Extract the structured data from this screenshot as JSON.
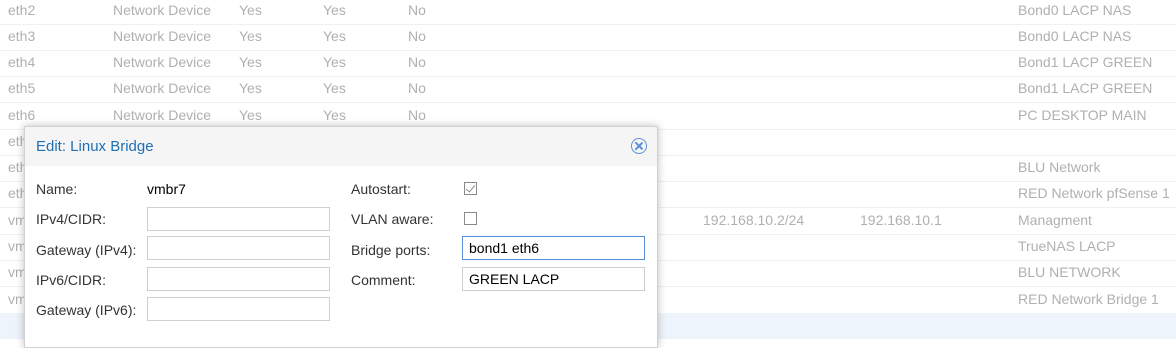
{
  "rows": [
    {
      "name": "eth2",
      "type": "Network Device",
      "active": "Yes",
      "autostart": "Yes",
      "vlan": "No",
      "cidr": "",
      "gateway": "",
      "comment": "Bond0 LACP NAS"
    },
    {
      "name": "eth3",
      "type": "Network Device",
      "active": "Yes",
      "autostart": "Yes",
      "vlan": "No",
      "cidr": "",
      "gateway": "",
      "comment": "Bond0 LACP NAS"
    },
    {
      "name": "eth4",
      "type": "Network Device",
      "active": "Yes",
      "autostart": "Yes",
      "vlan": "No",
      "cidr": "",
      "gateway": "",
      "comment": "Bond1 LACP GREEN"
    },
    {
      "name": "eth5",
      "type": "Network Device",
      "active": "Yes",
      "autostart": "Yes",
      "vlan": "No",
      "cidr": "",
      "gateway": "",
      "comment": "Bond1 LACP GREEN"
    },
    {
      "name": "eth6",
      "type": "Network Device",
      "active": "Yes",
      "autostart": "Yes",
      "vlan": "No",
      "cidr": "",
      "gateway": "",
      "comment": "PC DESKTOP MAIN"
    },
    {
      "name": "eth",
      "type": "",
      "active": "",
      "autostart": "",
      "vlan": "",
      "cidr": "",
      "gateway": "",
      "comment": ""
    },
    {
      "name": "eth",
      "type": "",
      "active": "",
      "autostart": "",
      "vlan": "",
      "cidr": "",
      "gateway": "",
      "comment": "BLU Network"
    },
    {
      "name": "eth",
      "type": "",
      "active": "",
      "autostart": "",
      "vlan": "",
      "cidr": "",
      "gateway": "",
      "comment": "RED Network pfSense 1"
    },
    {
      "name": "vm",
      "type": "",
      "active": "",
      "autostart": "",
      "vlan": "",
      "cidr": "192.168.10.2/24",
      "gateway": "192.168.10.1",
      "comment": "Managment"
    },
    {
      "name": "vm",
      "type": "",
      "active": "",
      "autostart": "",
      "vlan": "",
      "cidr": "",
      "gateway": "",
      "comment": "TrueNAS LACP"
    },
    {
      "name": "vm",
      "type": "",
      "active": "",
      "autostart": "",
      "vlan": "",
      "cidr": "",
      "gateway": "",
      "comment": "BLU NETWORK"
    },
    {
      "name": "vm",
      "type": "",
      "active": "",
      "autostart": "",
      "vlan": "",
      "cidr": "",
      "gateway": "",
      "comment": "RED Network Bridge 1"
    }
  ],
  "dialog": {
    "title": "Edit: Linux Bridge",
    "close_icon": "close-circle-icon",
    "name_label": "Name:",
    "name_value": "vmbr7",
    "ipv4_label": "IPv4/CIDR:",
    "ipv4_value": "",
    "gw4_label": "Gateway (IPv4):",
    "gw4_value": "",
    "ipv6_label": "IPv6/CIDR:",
    "ipv6_value": "",
    "gw6_label": "Gateway (IPv6):",
    "gw6_value": "",
    "autostart_label": "Autostart:",
    "autostart_checked": true,
    "vlan_label": "VLAN aware:",
    "vlan_checked": false,
    "ports_label": "Bridge ports:",
    "ports_value": "bond1 eth6",
    "comment_label": "Comment:",
    "comment_value": "GREEN LACP"
  },
  "colors": {
    "accent": "#1f6fb5",
    "grid_text": "#b0b0b0",
    "selected_row_bg": "#eef4fb"
  }
}
